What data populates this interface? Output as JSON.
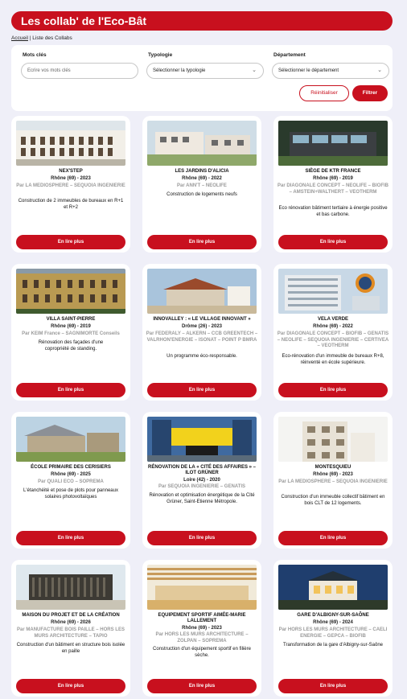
{
  "header": {
    "title": "Les collab' de l'Eco-Bât"
  },
  "breadcrumb": {
    "home": "Accueil",
    "separator": " | ",
    "current": "Liste des Collabs"
  },
  "filters": {
    "keywords_label": "Mots clés",
    "keywords_placeholder": "Ecrire vos mots clés",
    "typology_label": "Typologie",
    "typology_value": "Sélectionner la typologie",
    "department_label": "Département",
    "department_value": "Sélectionner le département",
    "reset_label": "Réinitialiser",
    "filter_label": "Filtrer"
  },
  "cards": [
    {
      "title": "NEX'STEP",
      "location": "Rhône (69) - 2023",
      "by": "Par LA MEDIOSPHERE – SEQUOIA INGENIERIE",
      "desc": "Construction de 2 immeubles de bureaux en R+1 et R+2",
      "button": "En lire plus"
    },
    {
      "title": "LES JARDINS D'ALICIA",
      "location": "Rhône (69) - 2022",
      "by": "Par ANN'T – NEOLIFE",
      "desc": "Construction de logements neufs",
      "button": "En lire plus"
    },
    {
      "title": "SIÈGE DE KTR FRANCE",
      "location": "Rhône (69) - 2019",
      "by": "Par DIAGONALE CONCEPT – NEOLIFE – BIOFIB – AMSTEIN+WALTHERT – VEOTHERM",
      "desc": "Eco rénovation bâtiment tertiaire à énergie positive et bas carbone.",
      "button": "En lire plus"
    },
    {
      "title": "VILLA SAINT-PIERRE",
      "location": "Rhône (69) - 2019",
      "by": "Par KEIM France – SAGNIMORTE Conseils",
      "desc": "Rénovation des façades d'une copropriété de standing.",
      "button": "En lire plus"
    },
    {
      "title": "INNOVALLEY : « LE VILLAGE INNOVANT »",
      "location": "Drôme (26) - 2023",
      "by": "Par FEDERALY – ALKERN – CCB GREENTECH – VALRHON'ENERGIE – ISONAT – POINT P BMRA",
      "desc": "Un programme éco-responsable.",
      "button": "En lire plus"
    },
    {
      "title": "VELA VERDE",
      "location": "Rhône (69) - 2022",
      "by": "Par DIAGONALE CONCEPT – BIOFIB – GENATIS – NEOLIFE – SEQUOIA INGENIERIE – CERTIVEA – VEOTHERM",
      "desc": "Eco-rénovation d'un immeuble de bureaux R+8, réinventé en école supérieure.",
      "button": "En lire plus"
    },
    {
      "title": "ÉCOLE PRIMAIRE DES CERISIERS",
      "location": "Rhône (69) - 2025",
      "by": "Par QUALI ECO – SOPREMA",
      "desc": "L'étanchéité et pose de plots pour panneaux solaires photovoltaïques",
      "button": "En lire plus"
    },
    {
      "title": "RÉNOVATION DE LA « CITÉ DES AFFAIRES » – ILOT GRÜNER",
      "location": "Loire (42) - 2020",
      "by": "Par SEQUOIA INGENIERIE – GENATIS",
      "desc": "Rénovation et optimisation énergétique de la Cité Grüner, Saint-Etienne Métropole.",
      "button": "En lire plus"
    },
    {
      "title": "MONTESQUIEU",
      "location": "Rhône (69) - 2023",
      "by": "Par LA MEDIOSPHERE – SEQUOIA INGENIERIE",
      "desc": "Construction d'un immeuble collectif bâtiment en bois CLT de 12 logements.",
      "button": "En lire plus"
    },
    {
      "title": "MAISON DU PROJET ET DE LA CRÉATION",
      "location": "Rhône (69) - 2026",
      "by": "Par MANUFACTURE BOIS PAILLE – HORS LES MURS ARCHITECTURE – TAPIO",
      "desc": "Construction d'un bâtiment en structure bois isolée en paille",
      "button": "En lire plus"
    },
    {
      "title": "EQUIPEMENT SPORTIF AIMÉE-MARIE LALLEMENT",
      "location": "Rhône (69) - 2023",
      "by": "Par HORS LES MURS ARCHITECTURE – ZOLPAN – SOPREMA",
      "desc": "Construction d'un équipement sportif en filière sèche.",
      "button": "En lire plus"
    },
    {
      "title": "GARE D'ALBIGNY-SUR-SAÔNE",
      "location": "Rhône (69) - 2024",
      "by": "Par HORS LES MURS ARCHITECTURE – CAELI ENERGIE – GEPCA – BIOFIB",
      "desc": "Transformation de la gare d'Albigny-sur-Saône",
      "button": "En lire plus"
    }
  ]
}
